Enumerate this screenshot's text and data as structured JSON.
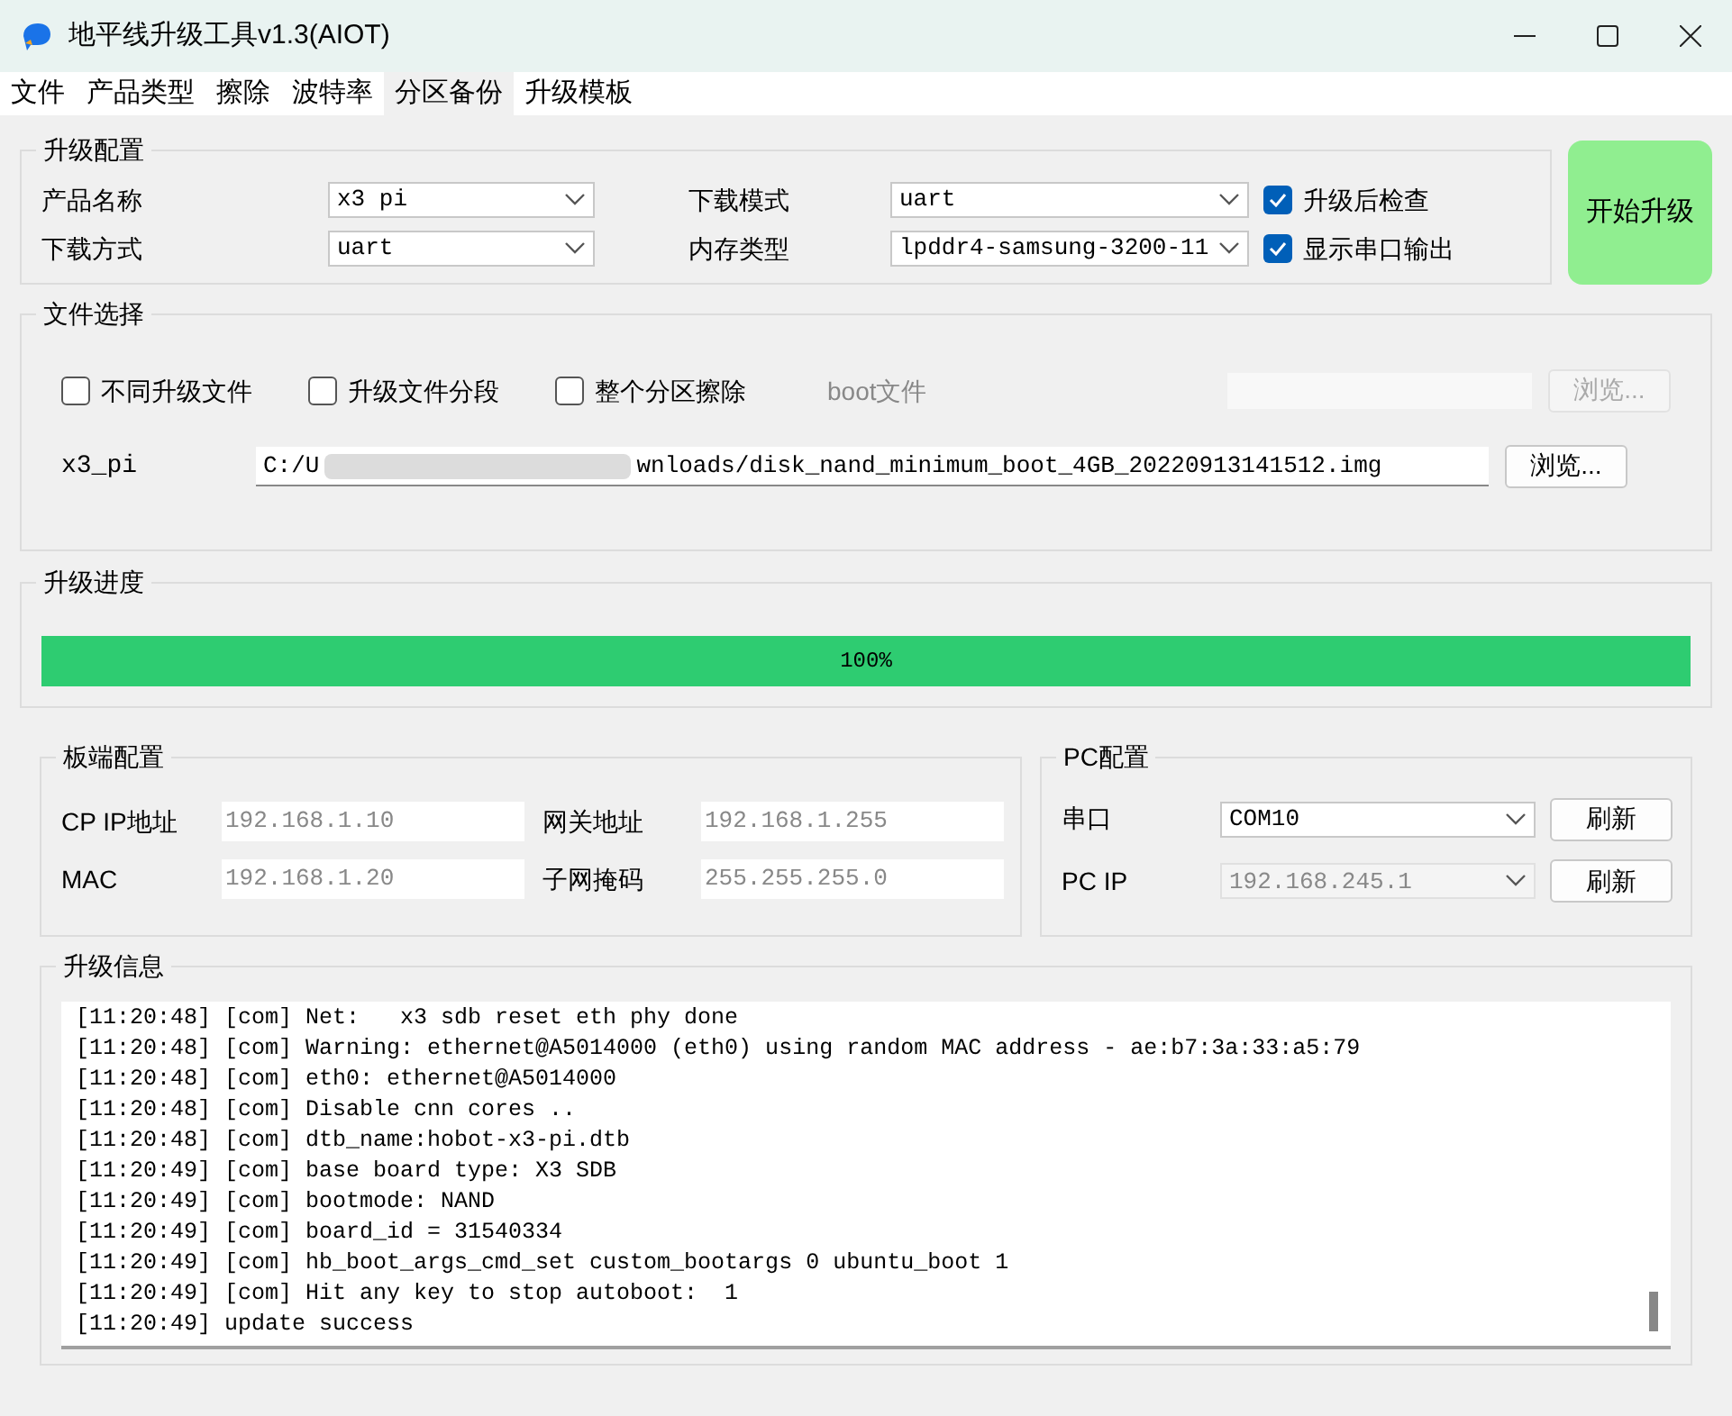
{
  "window": {
    "title": "地平线升级工具v1.3(AIOT)"
  },
  "menu": [
    {
      "label": "文件",
      "selected": false
    },
    {
      "label": "产品类型",
      "selected": false
    },
    {
      "label": "擦除",
      "selected": false
    },
    {
      "label": "波特率",
      "selected": false
    },
    {
      "label": "分区备份",
      "selected": true
    },
    {
      "label": "升级模板",
      "selected": false
    }
  ],
  "upgrade_config": {
    "title": "升级配置",
    "fields": [
      {
        "label": "产品名称",
        "value": "x3 pi"
      },
      {
        "label": "下载方式",
        "value": "uart"
      }
    ],
    "fields_2": [
      {
        "label": "下载模式",
        "value": "uart"
      },
      {
        "label": "内存类型",
        "value": "lpddr4-samsung-3200-11"
      }
    ],
    "checks": [
      {
        "label": "升级后检查",
        "checked": true
      },
      {
        "label": "显示串口输出",
        "checked": true
      }
    ]
  },
  "start_button": "开始升级",
  "file_select": {
    "title": "文件选择",
    "checks": [
      {
        "label": "不同升级文件",
        "checked": false
      },
      {
        "label": "升级文件分段",
        "checked": false
      },
      {
        "label": "整个分区擦除",
        "checked": false
      }
    ],
    "boot": {
      "label": "boot文件",
      "disabled": true,
      "button": "浏览..."
    },
    "file": {
      "label": "x3_pi",
      "value_start": "C:/U",
      "value_end": "wnloads/disk_nand_minimum_boot_4GB_20220913141512.img",
      "button": "浏览..."
    }
  },
  "progress": {
    "title": "升级进度",
    "level": 1,
    "reading": "100%"
  },
  "board_config": {
    "title": "板端配置",
    "fields": [
      {
        "label": "CP IP地址",
        "placeholder": "192.168.1.10"
      },
      {
        "label": "网关地址",
        "placeholder": "192.168.1.255"
      },
      {
        "label": "MAC",
        "placeholder": "192.168.1.20"
      },
      {
        "label": "子网掩码",
        "placeholder": "255.255.255.0"
      }
    ]
  },
  "pc_config": {
    "title": "PC配置",
    "rows": [
      {
        "label": "串口",
        "value": "COM10",
        "disabled": false,
        "button": "刷新"
      },
      {
        "label": "PC IP",
        "value": "192.168.245.1",
        "disabled": true,
        "button": "刷新"
      }
    ]
  },
  "log": {
    "title": "升级信息",
    "lines": [
      "[11:20:48] [com] Net:   x3 sdb reset eth phy done",
      "[11:20:48] [com] Warning: ethernet@A5014000 (eth0) using random MAC address - ae:b7:3a:33:a5:79",
      "[11:20:48] [com] eth0: ethernet@A5014000",
      "[11:20:48] [com] Disable cnn cores ..",
      "[11:20:48] [com] dtb_name:hobot-x3-pi.dtb",
      "[11:20:49] [com] base board type: X3 SDB",
      "[11:20:49] [com] bootmode: NAND",
      "[11:20:49] [com] board_id = 31540334",
      "[11:20:49] [com] hb_boot_args_cmd_set custom_bootargs 0 ubuntu_boot 1",
      "[11:20:49] [com] Hit any key to stop autoboot:  1",
      "[11:20:49] update success"
    ]
  }
}
